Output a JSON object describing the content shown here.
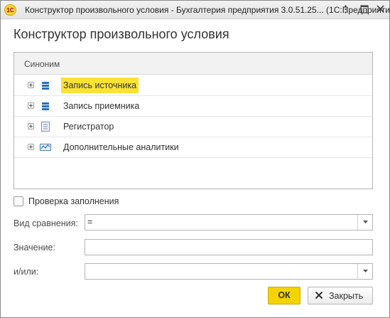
{
  "window": {
    "app_icon_text": "1С",
    "title": "Конструктор произвольного условия - Бухгалтерия предприятия 3.0.51.25...  (1С:Предприятие)"
  },
  "form": {
    "title": "Конструктор произвольного условия"
  },
  "tree": {
    "column_header": "Синоним",
    "rows": [
      {
        "label": "Запись источника",
        "icon": "register-records-icon",
        "selected": true
      },
      {
        "label": "Запись приемника",
        "icon": "register-records-icon",
        "selected": false
      },
      {
        "label": "Регистратор",
        "icon": "document-icon",
        "selected": false
      },
      {
        "label": "Дополнительные аналитики",
        "icon": "analytics-icon",
        "selected": false
      }
    ]
  },
  "fill_check": {
    "label": "Проверка заполнения",
    "checked": false
  },
  "comparison": {
    "label": "Вид сравнения:",
    "value": "="
  },
  "value_field": {
    "label": "Значение:",
    "value": ""
  },
  "andor_field": {
    "label": "и/или:",
    "value": ""
  },
  "buttons": {
    "ok": "ОК",
    "close": "Закрыть"
  },
  "colors": {
    "accent": "#f5d300",
    "selection": "#fbe234"
  }
}
